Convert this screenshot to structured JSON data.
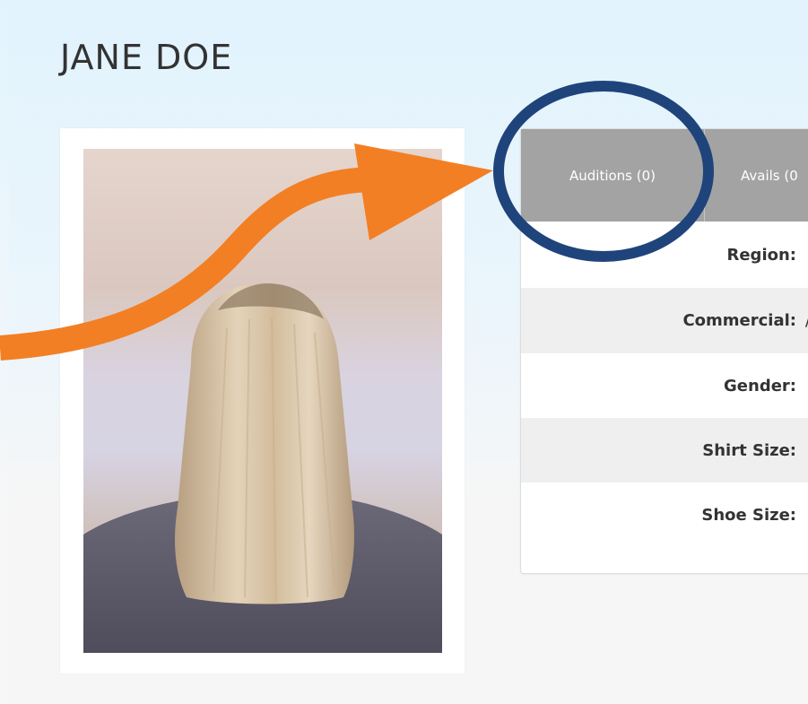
{
  "profile": {
    "name": "JANE DOE"
  },
  "tabs": [
    {
      "label": "Auditions (0)"
    },
    {
      "label": "Avails (0"
    }
  ],
  "details": [
    {
      "label": "Region:",
      "value": ""
    },
    {
      "label": "Commercial:",
      "value": "/"
    },
    {
      "label": "Gender:",
      "value": ""
    },
    {
      "label": "Shirt Size:",
      "value": ""
    },
    {
      "label": "Shoe Size:",
      "value": ""
    }
  ],
  "colors": {
    "arrow": "#f37f24",
    "highlight_circle": "#1f447b",
    "tab_bar": "#a3a3a3"
  },
  "icons": {
    "annotation_arrow": "curved-arrow-icon",
    "annotation_circle": "highlight-circle-icon"
  }
}
